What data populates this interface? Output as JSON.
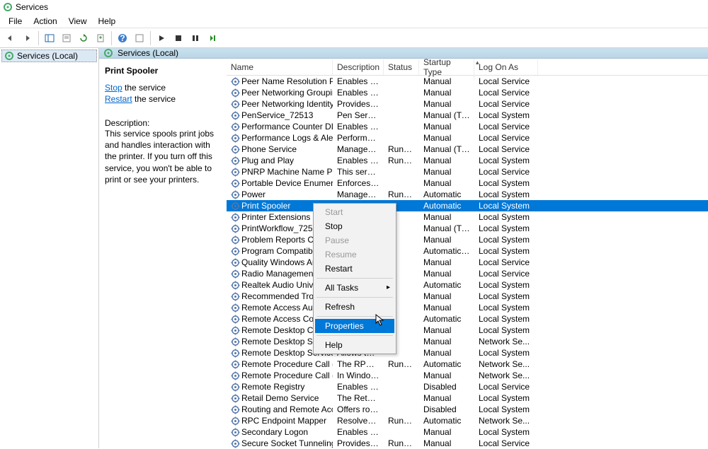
{
  "window": {
    "title": "Services"
  },
  "menu": {
    "file": "File",
    "action": "Action",
    "view": "View",
    "help": "Help"
  },
  "tree": {
    "root": "Services (Local)"
  },
  "header": {
    "label": "Services (Local)"
  },
  "detail": {
    "name": "Print Spooler",
    "stop_link": "Stop",
    "stop_rest": " the service",
    "restart_link": "Restart",
    "restart_rest": " the service",
    "desc_label": "Description:",
    "desc_text": "This service spools print jobs and handles interaction with the printer. If you turn off this service, you won't be able to print or see your printers."
  },
  "columns": {
    "name": "Name",
    "description": "Description",
    "status": "Status",
    "startup": "Startup Type",
    "logon": "Log On As"
  },
  "context": {
    "start": "Start",
    "stop": "Stop",
    "pause": "Pause",
    "resume": "Resume",
    "restart": "Restart",
    "alltasks": "All Tasks",
    "refresh": "Refresh",
    "properties": "Properties",
    "help": "Help"
  },
  "services": [
    {
      "name": "Peer Name Resolution Proto...",
      "desc": "Enables serv...",
      "status": "",
      "startup": "Manual",
      "logon": "Local Service"
    },
    {
      "name": "Peer Networking Grouping",
      "desc": "Enables mul...",
      "status": "",
      "startup": "Manual",
      "logon": "Local Service"
    },
    {
      "name": "Peer Networking Identity M...",
      "desc": "Provides ide...",
      "status": "",
      "startup": "Manual",
      "logon": "Local Service"
    },
    {
      "name": "PenService_72513",
      "desc": "Pen Service",
      "status": "",
      "startup": "Manual (Trigg...",
      "logon": "Local System"
    },
    {
      "name": "Performance Counter DLL H...",
      "desc": "Enables rem...",
      "status": "",
      "startup": "Manual",
      "logon": "Local Service"
    },
    {
      "name": "Performance Logs & Alerts",
      "desc": "Performance...",
      "status": "",
      "startup": "Manual",
      "logon": "Local Service"
    },
    {
      "name": "Phone Service",
      "desc": "Manages th...",
      "status": "Running",
      "startup": "Manual (Trigg...",
      "logon": "Local Service"
    },
    {
      "name": "Plug and Play",
      "desc": "Enables a co...",
      "status": "Running",
      "startup": "Manual",
      "logon": "Local System"
    },
    {
      "name": "PNRP Machine Name Public...",
      "desc": "This service ...",
      "status": "",
      "startup": "Manual",
      "logon": "Local Service"
    },
    {
      "name": "Portable Device Enumerator ...",
      "desc": "Enforces gro...",
      "status": "",
      "startup": "Manual",
      "logon": "Local System"
    },
    {
      "name": "Power",
      "desc": "Manages po...",
      "status": "Running",
      "startup": "Automatic",
      "logon": "Local System"
    },
    {
      "name": "Print Spooler",
      "desc": "",
      "status": "",
      "startup": "Automatic",
      "logon": "Local System",
      "selected": true
    },
    {
      "name": "Printer Extensions and Notifi...",
      "desc": "",
      "status": "",
      "startup": "Manual",
      "logon": "Local System"
    },
    {
      "name": "PrintWorkflow_72513",
      "desc": "",
      "status": "",
      "startup": "Manual (Trigg...",
      "logon": "Local System"
    },
    {
      "name": "Problem Reports Control Pa...",
      "desc": "",
      "status": "",
      "startup": "Manual",
      "logon": "Local System"
    },
    {
      "name": "Program Compatibility Assis...",
      "desc": "",
      "status": "",
      "startup": "Automatic (De...",
      "logon": "Local System"
    },
    {
      "name": "Quality Windows Audio Vid...",
      "desc": "",
      "status": "",
      "startup": "Manual",
      "logon": "Local Service"
    },
    {
      "name": "Radio Management Service",
      "desc": "",
      "status": "",
      "startup": "Manual",
      "logon": "Local Service"
    },
    {
      "name": "Realtek Audio Universal Serv...",
      "desc": "",
      "status": "",
      "startup": "Automatic",
      "logon": "Local System"
    },
    {
      "name": "Recommended Troubleshoo...",
      "desc": "",
      "status": "",
      "startup": "Manual",
      "logon": "Local System"
    },
    {
      "name": "Remote Access Auto Connec...",
      "desc": "",
      "status": "",
      "startup": "Manual",
      "logon": "Local System"
    },
    {
      "name": "Remote Access Connection ...",
      "desc": "",
      "status": "",
      "startup": "Automatic",
      "logon": "Local System"
    },
    {
      "name": "Remote Desktop Configurati...",
      "desc": "",
      "status": "",
      "startup": "Manual",
      "logon": "Local System"
    },
    {
      "name": "Remote Desktop Services",
      "desc": "",
      "status": "",
      "startup": "Manual",
      "logon": "Network Se..."
    },
    {
      "name": "Remote Desktop Services Us...",
      "desc": "Allows the re...",
      "status": "",
      "startup": "Manual",
      "logon": "Local System"
    },
    {
      "name": "Remote Procedure Call (RPC)",
      "desc": "The RPCSS s...",
      "status": "Running",
      "startup": "Automatic",
      "logon": "Network Se..."
    },
    {
      "name": "Remote Procedure Call (RPC)...",
      "desc": "In Windows ...",
      "status": "",
      "startup": "Manual",
      "logon": "Network Se..."
    },
    {
      "name": "Remote Registry",
      "desc": "Enables rem...",
      "status": "",
      "startup": "Disabled",
      "logon": "Local Service"
    },
    {
      "name": "Retail Demo Service",
      "desc": "The Retail D...",
      "status": "",
      "startup": "Manual",
      "logon": "Local System"
    },
    {
      "name": "Routing and Remote Access",
      "desc": "Offers routi...",
      "status": "",
      "startup": "Disabled",
      "logon": "Local System"
    },
    {
      "name": "RPC Endpoint Mapper",
      "desc": "Resolves RP...",
      "status": "Running",
      "startup": "Automatic",
      "logon": "Network Se..."
    },
    {
      "name": "Secondary Logon",
      "desc": "Enables start...",
      "status": "",
      "startup": "Manual",
      "logon": "Local System"
    },
    {
      "name": "Secure Socket Tunneling Pro...",
      "desc": "Provides sup...",
      "status": "Running",
      "startup": "Manual",
      "logon": "Local Service"
    }
  ]
}
